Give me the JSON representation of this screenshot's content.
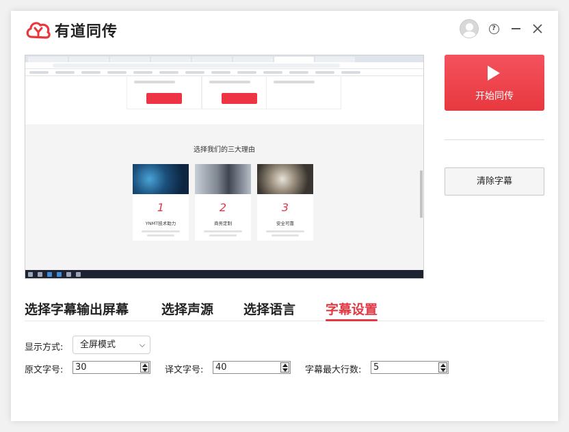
{
  "app": {
    "logo_text": "有道同传",
    "brand_color": "#e8383f"
  },
  "header": {
    "avatar_icon": "user-avatar-icon",
    "help_label": "?",
    "minimize_icon": "minimize-icon",
    "close_icon": "close-icon"
  },
  "preview": {
    "section_title": "选择我们的三大理由",
    "cards": [
      {
        "num": "1",
        "name": "YNMT技术助力"
      },
      {
        "num": "2",
        "name": "商务定制"
      },
      {
        "num": "3",
        "name": "安全可靠"
      }
    ]
  },
  "actions": {
    "start_label": "开始同传",
    "clear_label": "清除字幕"
  },
  "tabs": [
    {
      "label": "选择字幕输出屏幕",
      "active": false
    },
    {
      "label": "选择声源",
      "active": false
    },
    {
      "label": "选择语言",
      "active": false
    },
    {
      "label": "字幕设置",
      "active": true
    }
  ],
  "settings": {
    "display_mode_label": "显示方式:",
    "display_mode_value": "全屏模式",
    "source_font_label": "原文字号:",
    "source_font_value": "30",
    "target_font_label": "译文字号:",
    "target_font_value": "40",
    "max_lines_label": "字幕最大行数:",
    "max_lines_value": "5"
  }
}
